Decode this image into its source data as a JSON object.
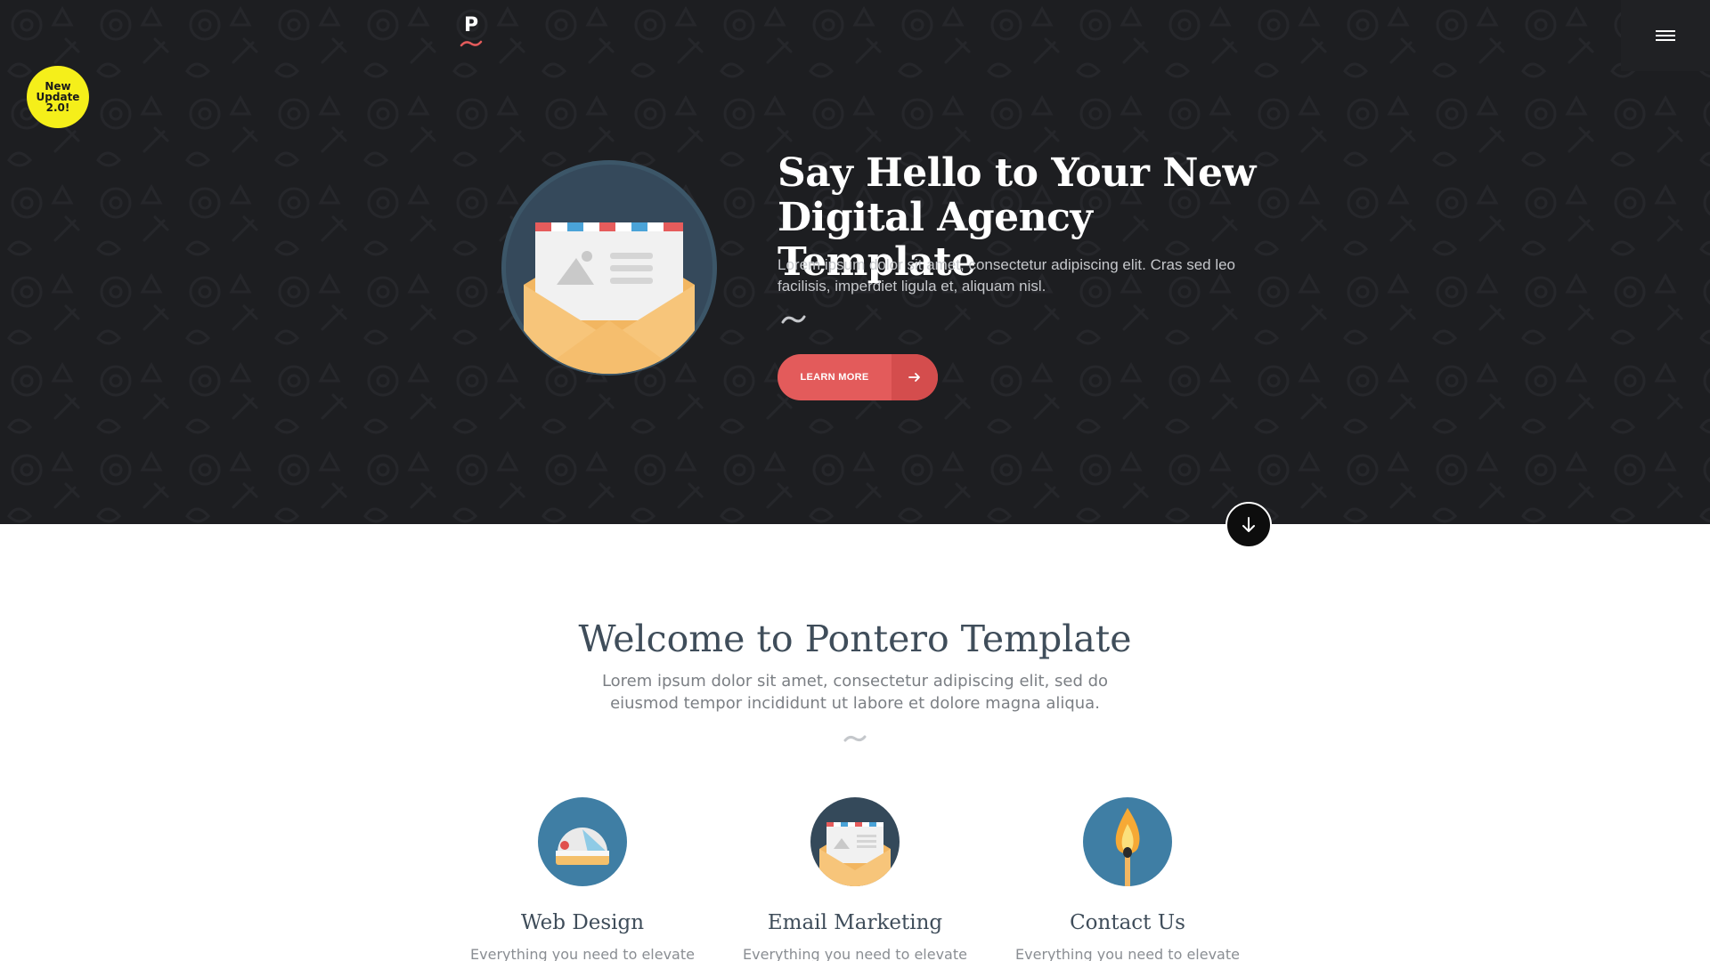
{
  "logo": {
    "letter": "P"
  },
  "badge": {
    "text": "New Update 2.0!"
  },
  "hero": {
    "title": "Say Hello to Your New Digital Agency Template",
    "text": "Lorem ipsum dolor sit amet, consectetur adipiscing elit. Cras sed leo facilisis, imperdiet ligula et, aliquam nisl.",
    "button_label": "LEARN MORE",
    "accent_color": "#e35b5b",
    "background_color": "#1d1e21"
  },
  "welcome": {
    "title": "Welcome to Pontero Template",
    "text": "Lorem ipsum dolor sit amet, consectetur adipiscing elit, sed do eiusmod tempor incididunt ut labore et dolore magna aliqua."
  },
  "features": [
    {
      "title": "Web Design",
      "text": "Everything you need to elevate",
      "icon": "web-design-icon"
    },
    {
      "title": "Email Marketing",
      "text": "Everything you need to elevate",
      "icon": "envelope-icon"
    },
    {
      "title": "Contact Us",
      "text": "Everything you need to elevate",
      "icon": "match-flame-icon"
    }
  ],
  "icons": {
    "menu": "hamburger-menu-icon",
    "scroll": "arrow-down-icon",
    "button_arrow": "arrow-right-icon"
  }
}
